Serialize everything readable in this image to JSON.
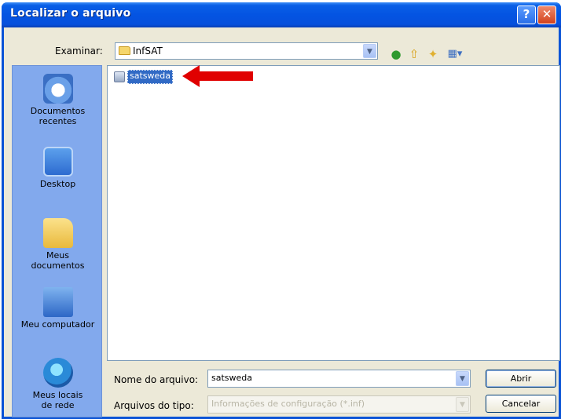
{
  "window": {
    "title": "Localizar o arquivo",
    "help_label": "?",
    "close_label": "✕"
  },
  "lookin": {
    "label": "Examinar:",
    "value": "InfSAT"
  },
  "toolbar": {
    "back_icon": "back-icon",
    "up_icon": "up-folder-icon",
    "new_folder_icon": "new-folder-icon",
    "views_icon": "views-menu-icon"
  },
  "places": [
    {
      "label": "Documentos recentes",
      "icon": "recent-documents-icon"
    },
    {
      "label": "Desktop",
      "icon": "desktop-icon"
    },
    {
      "label": "Meus documentos",
      "icon": "my-documents-icon"
    },
    {
      "label": "Meu computador",
      "icon": "my-computer-icon"
    },
    {
      "label": "Meus locais de rede",
      "icon": "network-places-icon"
    }
  ],
  "files": [
    {
      "name": "satsweda",
      "selected": true
    }
  ],
  "filename": {
    "label": "Nome do arquivo:",
    "value": "satsweda"
  },
  "filetype": {
    "label": "Arquivos do tipo:",
    "value": "Informações de configuração (*.inf)"
  },
  "buttons": {
    "open": "Abrir",
    "cancel": "Cancelar"
  },
  "colors": {
    "title_bar": "#0454e2",
    "places_bar": "#82a9ed",
    "selection": "#316ac5",
    "annotation_arrow": "#e00000"
  }
}
